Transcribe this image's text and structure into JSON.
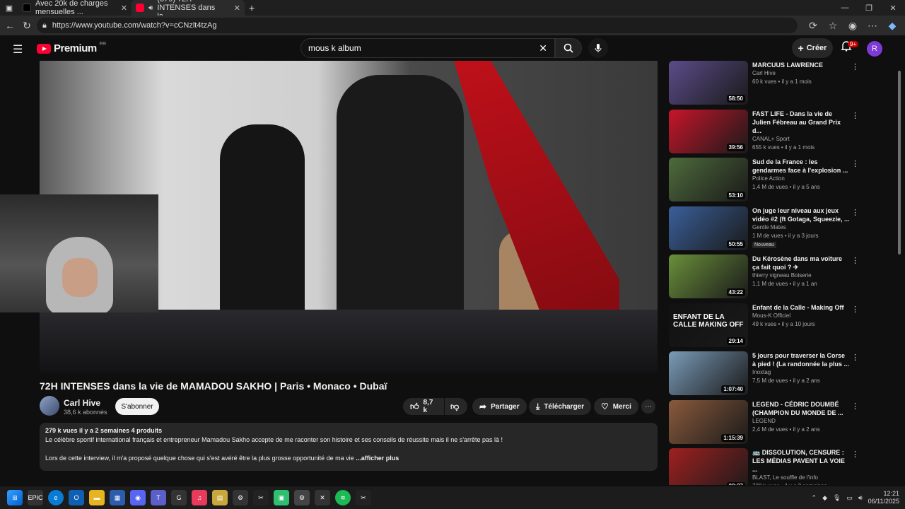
{
  "browser": {
    "tabs": [
      {
        "label": "Avec 20k de charges mensuelles ..."
      },
      {
        "label": "(379) 72H INTENSES dans la..."
      }
    ],
    "url": "https://www.youtube.com/watch?v=cCNzlt4tzAg"
  },
  "youtube": {
    "brand": "Premium",
    "region": "FR",
    "search_value": "mous k album",
    "create_label": "Créer",
    "notif_badge": "9+",
    "avatar_letter": "R"
  },
  "video": {
    "title": "72H INTENSES dans la vie de MAMADOU SAKHO | Paris • Monaco • Dubaï",
    "channel": "Carl Hive",
    "subscribers": "38,6 k abonnés",
    "subscribe_label": "S'abonner",
    "likes": "8,7 k",
    "share_label": "Partager",
    "download_label": "Télécharger",
    "thanks_label": "Merci",
    "desc_meta": "279 k vues  il y a 2 semaines  4 produits",
    "desc_line1": "Le célèbre sportif international français et entrepreneur Mamadou Sakho accepte de me raconter son histoire et ses conseils de réussite mais il ne s'arrête pas là !",
    "desc_line2": "Lors de cette interview, il m'a proposé quelque chose qui s'est avéré être la plus grosse opportunité de ma vie",
    "desc_more": "...afficher plus"
  },
  "sidebar": {
    "items": [
      {
        "title": "MARCUUS LAWRENCE",
        "channel": "Carl Hive",
        "meta": "60 k vues • il y a 1 mois",
        "duration": "58:50",
        "color": "#5b4c8a"
      },
      {
        "title": "FAST LIFE - Dans la vie de Julien Fébreau au Grand Prix d...",
        "channel": "CANAL+ Sport",
        "meta": "655 k vues • il y a 1 mois",
        "duration": "39:56",
        "color": "#c8152a"
      },
      {
        "title": "Sud de la France : les gendarmes face à l'explosion ...",
        "channel": "Police Action",
        "meta": "1,4 M de vues • il y a 5 ans",
        "duration": "53:10",
        "color": "#4e6b3c"
      },
      {
        "title": "On juge leur niveau aux jeux vidéo #2 (ft Gotaga, Squeezie, ...",
        "channel": "Gentle Mates",
        "meta": "1 M de vues • il y a 3 jours",
        "duration": "50:55",
        "color": "#3a5f9a",
        "badge": "Nouveau"
      },
      {
        "title": "Du Kérosène dans ma voiture ça fait quoi ? ✈",
        "channel": "thierry vigneau Boiserie",
        "meta": "1,1 M de vues • il y a 1 an",
        "duration": "43:22",
        "color": "#6a8f3a"
      },
      {
        "title": "Enfant de la Calle - Making Off",
        "channel": "Mous-K Officiel",
        "meta": "49 k vues • il y a 10 jours",
        "duration": "29:14",
        "color": "#111111",
        "thumb_text": "ENFANT DE LA CALLE MAKING OFF"
      },
      {
        "title": "5 jours pour traverser la Corse à pied ! (La randonnée la plus ...",
        "channel": "Inoxtag",
        "meta": "7,5 M de vues • il y a 2 ans",
        "duration": "1:07:40",
        "color": "#7a9bb8"
      },
      {
        "title": "LEGEND - CÉDRIC DOUMBÉ (CHAMPION DU MONDE DE ...",
        "channel": "LEGEND",
        "meta": "2,4 M de vues • il y a 2 ans",
        "duration": "1:15:39",
        "color": "#8a5a3c"
      },
      {
        "title": "🚌 DISSOLUTION, CENSURE : LES MÉDIAS PAVENT LA VOIE ...",
        "channel": "BLAST, Le souffle de l'info",
        "meta": "730 k vues • il y a 2 semaines",
        "duration": "20:37",
        "color": "#a02020"
      }
    ]
  },
  "taskbar": {
    "time": "12:21",
    "date": "06/11/2025"
  }
}
